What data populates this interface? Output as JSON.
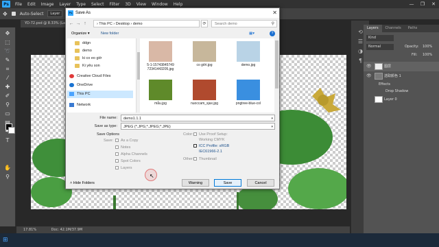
{
  "app": {
    "logo": "Ps"
  },
  "menubar": {
    "items": [
      "File",
      "Edit",
      "Image",
      "Layer",
      "Type",
      "Select",
      "Filter",
      "3D",
      "View",
      "Window",
      "Help"
    ]
  },
  "window_controls": {
    "minimize": "—",
    "restore": "❐",
    "close": "✕"
  },
  "options_bar": {
    "layer_select": "Layer",
    "auto_select": "Auto-Select"
  },
  "document": {
    "tab": "YD-72.psd @ 8.33% (Layer 0, RGB/8) *",
    "zoom": "17.81%",
    "doc_size": "Doc: 42.1M/37.9M"
  },
  "layers_panel": {
    "tabs": [
      "Layers",
      "Channels",
      "Paths"
    ],
    "kind": "Kind",
    "blend": "Normal",
    "opacity_label": "Opacity:",
    "opacity": "100%",
    "fill_label": "Fill:",
    "fill": "100%",
    "layers": [
      {
        "name": "图层"
      },
      {
        "name": "选取颜色 1"
      },
      {
        "name": "Effects"
      },
      {
        "name": "Drop Shadow"
      },
      {
        "name": "Layer 0"
      }
    ]
  },
  "dialog": {
    "title": "Save As",
    "breadcrumb": "› This PC › Desktop › demo",
    "search_placeholder": "Search demo",
    "organize": "Organize ▾",
    "new_folder": "New folder",
    "nav_items": [
      {
        "label": "ddgn",
        "icon": "folder-icon"
      },
      {
        "label": "demo",
        "icon": "folder-icon"
      },
      {
        "label": "ki co eo giờ",
        "icon": "folder-icon"
      },
      {
        "label": "Ki yêu son",
        "icon": "folder-icon"
      },
      {
        "label": "Creative Cloud Files",
        "icon": "cloud-icon"
      },
      {
        "label": "OneDrive",
        "icon": "onedrive-icon"
      },
      {
        "label": "This PC",
        "icon": "computer-icon",
        "selected": true
      },
      {
        "label": "Network",
        "icon": "network-icon"
      }
    ],
    "files": [
      {
        "name": "5-1-15743845749 72341443205.jpg",
        "thumb": "#d9b8a6"
      },
      {
        "name": "co giới.jpg",
        "thumb": "#c7b79b"
      },
      {
        "name": "demo.jpg",
        "thumb": "#b9d3e6"
      },
      {
        "name": "mẫu.jpg",
        "thumb": "#5f8a2a"
      },
      {
        "name": "nuoccam_sjax.jpg",
        "thumb": "#b04a2e"
      },
      {
        "name": "pngtree-blue-col",
        "thumb": "#3a8fe0"
      }
    ],
    "file_name_label": "File name:",
    "file_name": "demo1.1.1",
    "save_type_label": "Save as type:",
    "save_type": "JPEG (*.JPG;*.JPEG;*.JPE)",
    "save_options": {
      "heading": "Save Options",
      "save_label": "Save:",
      "as_copy": "As a Copy",
      "notes": "Notes",
      "alpha_channels": "Alpha Channels",
      "spot_colors": "Spot Colors",
      "layers": "Layers",
      "color_label": "Color:",
      "use_proof": "Use Proof Setup:",
      "working_cmyk": "Working CMYK",
      "icc_profile": "ICC Profile: sRGB",
      "icc_profile_2": "IEC61966-2.1",
      "other_label": "Other:",
      "thumbnail": "Thumbnail"
    },
    "hide_folders": "Hide Folders",
    "buttons": {
      "warning": "Warning",
      "save": "Save",
      "cancel": "Cancel"
    }
  }
}
